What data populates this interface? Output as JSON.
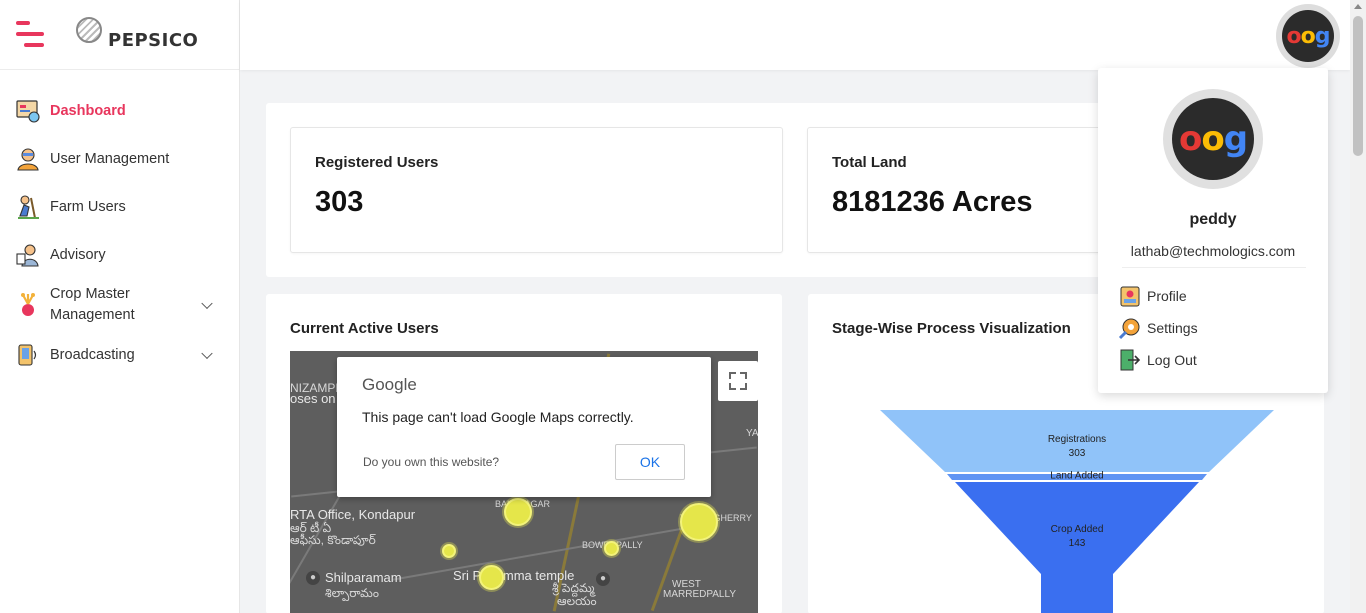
{
  "brand": {
    "name": "PEPSICO"
  },
  "sidebar": {
    "items": [
      {
        "label": "Dashboard",
        "icon": "dashboard-icon",
        "active": true
      },
      {
        "label": "User Management",
        "icon": "user-management-icon"
      },
      {
        "label": "Farm Users",
        "icon": "farm-users-icon"
      },
      {
        "label": "Advisory",
        "icon": "advisory-icon"
      },
      {
        "label": "Crop Master Management",
        "icon": "crop-master-icon",
        "expandable": true
      },
      {
        "label": "Broadcasting",
        "icon": "broadcasting-icon",
        "expandable": true
      }
    ]
  },
  "stats": {
    "registered_users": {
      "title": "Registered Users",
      "value": "303"
    },
    "total_land": {
      "title": "Total Land",
      "value": "8181236 Acres"
    }
  },
  "active_users": {
    "title": "Current Active Users",
    "map": {
      "labels": {
        "nizampet": "NIZAMPET",
        "poses": "oses on",
        "rta": "RTA Office, Kondapur",
        "rta_te1": "ఆర్ టీ ఏ",
        "rta_te2": "ఆఫీసు, కొండాపూర్",
        "shilparamam": "Shilparamam",
        "shilparamam_te": "శిల్పారామం",
        "temple": "Sri Pedamma temple",
        "temple_te1": "శ్రీ పెద్దమ్మ",
        "temple_te2": "ఆలయం",
        "west": "WEST",
        "marredpally": "MARREDPALLY",
        "bowenpally": "BOWENPALLY",
        "balanagar": "BALANAGAR",
        "trimulgherry": "TRIMULGHERRY",
        "ya": "YA"
      },
      "error_dialog": {
        "logo": "Google",
        "message": "This page can't load Google Maps correctly.",
        "own_link": "Do you own this website?",
        "ok_label": "OK"
      }
    }
  },
  "stage_wise": {
    "title": "Stage-Wise Process Visualization"
  },
  "chart_data": {
    "type": "funnel",
    "stages": [
      {
        "label": "Registrations",
        "value": 303,
        "color": "#90c3f9"
      },
      {
        "label": "Land Added",
        "value": null,
        "color": "#5f94f3"
      },
      {
        "label": "Crop Added",
        "value": 143,
        "color": "#3a6ff0"
      }
    ]
  },
  "profile": {
    "name": "peddy",
    "email": "lathab@techmologics.com",
    "menu": [
      {
        "label": "Profile",
        "icon": "profile-icon"
      },
      {
        "label": "Settings",
        "icon": "settings-gear-icon"
      },
      {
        "label": "Log Out",
        "icon": "logout-icon"
      }
    ]
  },
  "colors": {
    "accent": "#e8365d",
    "map_marker": "#e5e64a"
  }
}
